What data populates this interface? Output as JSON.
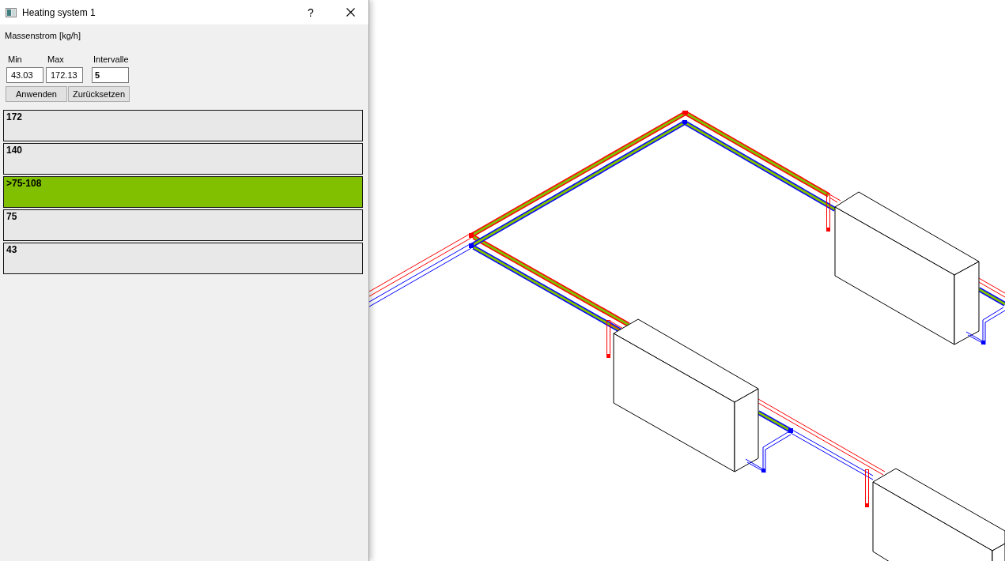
{
  "window": {
    "title": "Heating system 1",
    "help_button": "?"
  },
  "quantity_label": "Massenstrom [kg/h]",
  "fields": [
    {
      "label": "Min",
      "value": "43.03",
      "kind": "decimal"
    },
    {
      "label": "Max",
      "value": "172.13",
      "kind": "decimal"
    },
    {
      "label": "Intervalle",
      "value": "5",
      "kind": "integer"
    }
  ],
  "buttons": [
    "Anwenden",
    "Zurücksetzen"
  ],
  "legend": [
    {
      "label": "172",
      "selected": false
    },
    {
      "label": "140",
      "selected": false
    },
    {
      "label": ">75-108",
      "selected": true
    },
    {
      "label": "75",
      "selected": false
    },
    {
      "label": "43",
      "selected": false
    }
  ]
}
